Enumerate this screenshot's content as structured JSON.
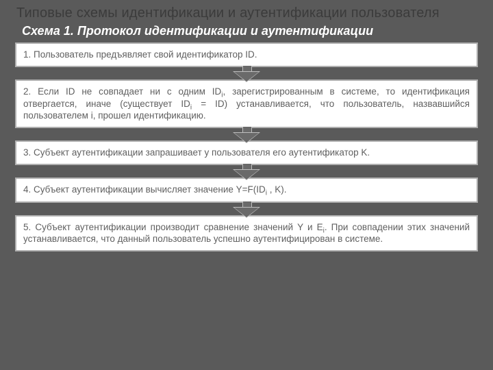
{
  "title": "Типовые схемы идентификации и аутентификации пользователя",
  "subtitle": "Схема 1. Протокол идентификации и аутентификации",
  "steps": {
    "s1": "1. Пользователь предъявляет свой идентификатор ID.",
    "s2_a": "2. Если ID не совпадает ни с одним ID",
    "s2_b": ", зарегистрированным в системе, то идентификация отвергается, иначе  (существует ID",
    "s2_c": " = ID) устанавливается, что пользователь, назвавшийся пользователем i, прошел идентификацию.",
    "s3": "3. Субъект аутентификации запрашивает у пользователя его аутентификатор K.",
    "s4_a": "4. Субъект аутентификации вычисляет значение Y=F(ID",
    "s4_b": " , K).",
    "s5_a": "5. Субъект аутентификации производит сравнение значений Y и E",
    "s5_b": ". При совпадении этих значений устанавливается, что данный пользователь успешно аутентифицирован в системе."
  },
  "sub_i": "i"
}
